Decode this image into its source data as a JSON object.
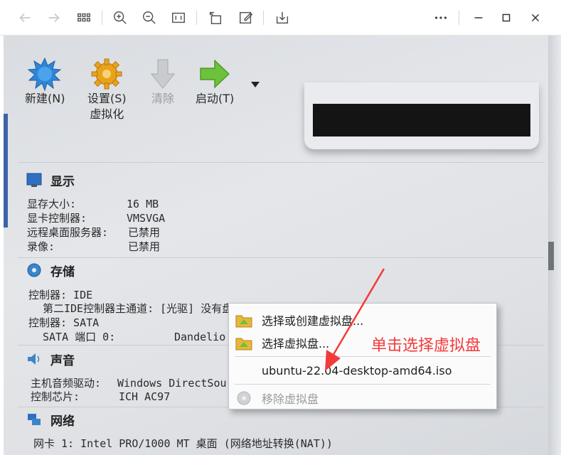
{
  "viewer": {
    "buttons": [
      "back-icon",
      "forward-icon",
      "grid-icon",
      "zoom-in-icon",
      "zoom-out-icon",
      "actual-size-icon",
      "rotate-icon",
      "edit-icon",
      "download-icon",
      "more-icon",
      "minimize-icon",
      "maximize-icon",
      "close-icon"
    ]
  },
  "toolbar": {
    "new_label": "新建(N)",
    "settings_label": "设置(S)",
    "settings_sub": "虚拟化",
    "discard_label": "清除",
    "start_label": "启动(T)"
  },
  "display": {
    "title": "显示",
    "rows": [
      {
        "key": "显存大小:",
        "value": "16 MB"
      },
      {
        "key": "显卡控制器:",
        "value": "VMSVGA"
      },
      {
        "key": "远程桌面服务器:",
        "value": "已禁用"
      },
      {
        "key": "录像:",
        "value": "已禁用"
      }
    ]
  },
  "storage": {
    "title": "存储",
    "controller_ide": "控制器: IDE",
    "ide_channel": "第二IDE控制器主通道: [光驱] 没有盘片",
    "controller_sata": "控制器: SATA",
    "sata_port": "SATA 端口 0:",
    "sata_value": "Dandelio"
  },
  "audio": {
    "title": "声音",
    "driver_key": "主机音频驱动:",
    "driver_value": "Windows DirectSou",
    "chip_key": "控制芯片:",
    "chip_value": "ICH AC97"
  },
  "network": {
    "title": "网络",
    "nic1": "网卡 1:  Intel PRO/1000 MT 桌面 (网络地址转换(NAT))"
  },
  "menu": {
    "items": [
      {
        "label": "选择或创建虚拟盘..."
      },
      {
        "label": "选择虚拟盘..."
      },
      {
        "label": "ubuntu-22.04-desktop-amd64.iso"
      },
      {
        "label": "移除虚拟盘"
      }
    ]
  },
  "annotation": {
    "text": "单击选择虚拟盘",
    "color": "#f23a3a"
  },
  "colors": {
    "photo_bg": "#dfe1e5",
    "annotation_red": "#f23a3a",
    "accent_blue": "#3d63a8"
  }
}
